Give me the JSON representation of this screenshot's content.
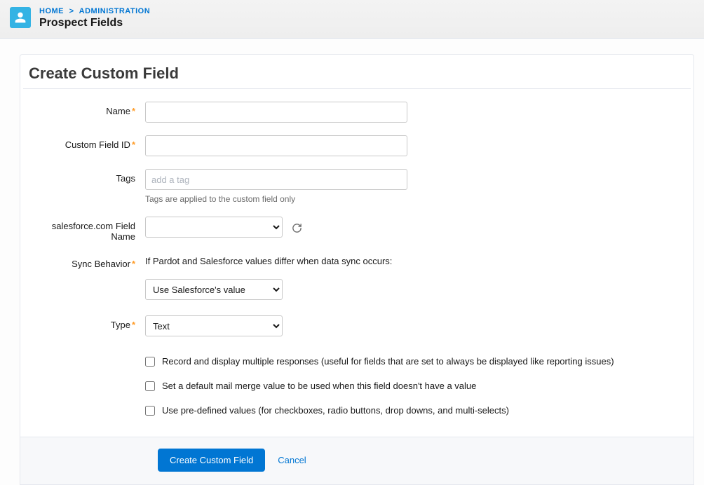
{
  "breadcrumb": {
    "home": "HOME",
    "separator": ">",
    "admin": "ADMINISTRATION"
  },
  "page_title": "Prospect Fields",
  "card_title": "Create Custom Field",
  "labels": {
    "name": "Name",
    "custom_field_id": "Custom Field ID",
    "tags": "Tags",
    "sf_field_name": "salesforce.com Field Name",
    "sync_behavior": "Sync Behavior",
    "type": "Type"
  },
  "hints": {
    "tags": "Tags are applied to the custom field only",
    "sync_desc": "If Pardot and Salesforce values differ when data sync occurs:"
  },
  "placeholders": {
    "tags": "add a tag"
  },
  "values": {
    "name": "",
    "custom_field_id": "",
    "tags": "",
    "sf_field_name": "",
    "sync_behavior": "Use Salesforce's value",
    "type": "Text"
  },
  "checkboxes": {
    "record_multi": "Record and display multiple responses (useful for fields that are set to always be displayed like reporting issues)",
    "default_merge": "Set a default mail merge value to be used when this field doesn't have a value",
    "predefined": "Use pre-defined values (for checkboxes, radio buttons, drop downs, and multi-selects)"
  },
  "buttons": {
    "create": "Create Custom Field",
    "cancel": "Cancel"
  }
}
